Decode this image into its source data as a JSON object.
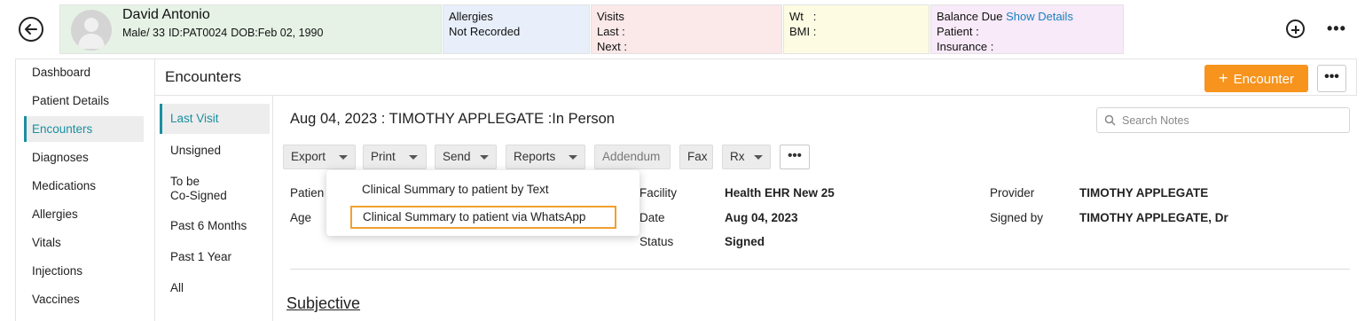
{
  "patient": {
    "name": "David Antonio",
    "gender_age": "Male/ 33",
    "id": "ID:PAT0024",
    "dob": "DOB:Feb 02, 1990"
  },
  "allergies": {
    "label": "Allergies",
    "value": "Not Recorded"
  },
  "visits": {
    "label": "Visits",
    "last": "Last :",
    "next": "Next :"
  },
  "vitals": {
    "wt": "Wt   :",
    "bmi": "BMI :"
  },
  "balance": {
    "label": "Balance Due",
    "link": "Show Details",
    "patient": "Patient :",
    "insurance": "Insurance :"
  },
  "left_nav": {
    "items": [
      "Dashboard",
      "Patient Details",
      "Encounters",
      "Diagnoses",
      "Medications",
      "Allergies",
      "Vitals",
      "Injections",
      "Vaccines"
    ],
    "active": "Encounters"
  },
  "encounters_header": {
    "title": "Encounters",
    "add_button": "Encounter",
    "more": "•••"
  },
  "sub_nav": {
    "items": [
      "Last Visit",
      "Unsigned",
      "To be Co-Signed",
      "Past 6 Months",
      "Past 1 Year",
      "All"
    ],
    "to_be_line1": "To be",
    "to_be_line2": "Co-Signed"
  },
  "encounter": {
    "title": "Aug 04, 2023 : TIMOTHY APPLEGATE :In Person",
    "search_placeholder": "Search Notes"
  },
  "toolbar": {
    "export": "Export",
    "print": "Print",
    "send": "Send",
    "reports": "Reports",
    "addendum": "Addendum",
    "fax": "Fax",
    "rx": "Rx",
    "more": "•••"
  },
  "details": {
    "patient_label": "Patien",
    "age_label": "Age",
    "facility_label": "Facility",
    "facility_value": "Health EHR New 25",
    "date_label": "Date",
    "date_value": "Aug 04, 2023",
    "status_label": "Status",
    "status_value": "Signed",
    "provider_label": "Provider",
    "provider_value": "TIMOTHY APPLEGATE",
    "signed_by_label": "Signed by",
    "signed_by_value": "TIMOTHY APPLEGATE, Dr"
  },
  "send_dropdown": {
    "items": [
      "Clinical Summary to patient by Text",
      "Clinical Summary to patient via WhatsApp"
    ]
  },
  "section": {
    "subjective": "Subjective"
  },
  "colors": {
    "accent": "#f7941d",
    "active_nav": "#1a8fa0",
    "link": "#1a7fc0"
  }
}
